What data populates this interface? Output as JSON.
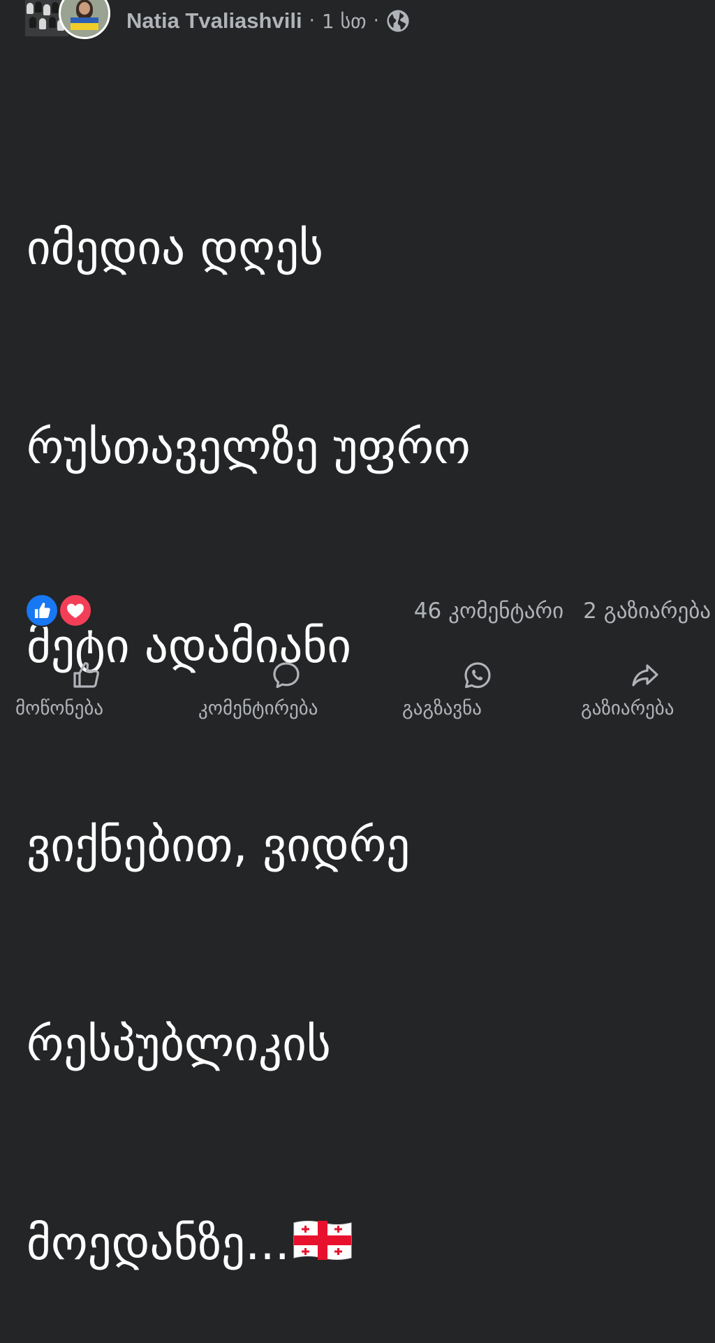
{
  "post": {
    "author": "Natia Tvaliashvili",
    "separator": "·",
    "time_ago": "1 სთ",
    "audience_icon": "globe-icon",
    "text_lines": [
      "იმედია დღეს",
      "რუსთაველზე უფრო",
      "მეტი ადამიანი",
      "ვიქნებით, ვიდრე",
      "რესპუბლიკის",
      "მოედანზე..."
    ],
    "emoji": "georgian-flag"
  },
  "engagement": {
    "reactions": [
      "like",
      "love"
    ],
    "comments": "46 კომენტარი",
    "shares": "2 გაზიარება"
  },
  "actions": [
    {
      "label": "მოწონება",
      "icon": "like-icon"
    },
    {
      "label": "კომენტირება",
      "icon": "comment-icon"
    },
    {
      "label": "გაგზავნა",
      "icon": "whatsapp-icon"
    },
    {
      "label": "გაზიარება",
      "icon": "share-icon"
    }
  ],
  "colors": {
    "background": "#242526",
    "text_primary": "#ffffff",
    "text_secondary": "#b0b3b8",
    "like_blue": "#1877f2",
    "love_red": "#f33e58"
  }
}
